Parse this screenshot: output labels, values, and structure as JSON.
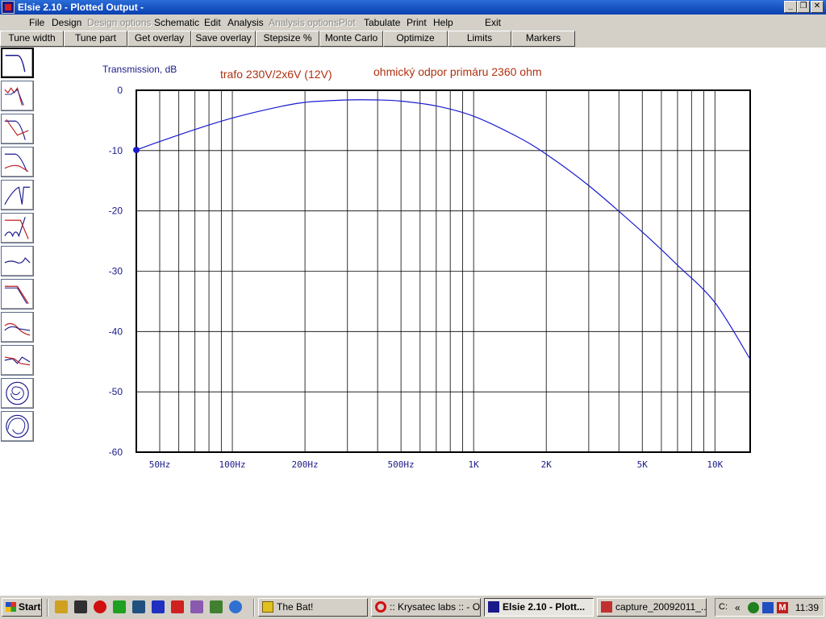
{
  "window": {
    "title": "Elsie 2.10 - Plotted Output -",
    "controls": {
      "minimize": "_",
      "restore": "❐",
      "close": "✕"
    }
  },
  "menu": {
    "file": "File",
    "design": "Design",
    "design_options": "Design options",
    "schematic": "Schematic",
    "edit": "Edit",
    "analysis": "Analysis",
    "analysis_options": "Analysis options",
    "plot": "Plot",
    "tabulate": "Tabulate",
    "print": "Print",
    "help": "Help",
    "exit": "Exit"
  },
  "toolbar": {
    "tune_width": "Tune width",
    "tune_part": "Tune part",
    "get_overlay": "Get overlay",
    "save_overlay": "Save overlay",
    "stepsize": "Stepsize %",
    "monte_carlo": "Monte Carlo",
    "optimize": "Optimize",
    "limits": "Limits",
    "markers": "Markers"
  },
  "sidebar": {
    "icons": [
      "lowpass-response-icon",
      "ripple-lowpass-icon",
      "lowpass-phase-icon",
      "lowpass-delay-icon",
      "highpass-notch-icon",
      "bandstop-icon",
      "step-response-icon",
      "rolloff-icon",
      "bandpass-icon",
      "crossover-icon",
      "smith-chart-icon",
      "polar-chart-icon"
    ]
  },
  "chart_data": {
    "type": "line",
    "ylabel": "Transmission, dB",
    "annotations": [
      "trafo 230V/2x6V  (12V)",
      "ohmický odpor primáru 2360 ohm"
    ],
    "x_scale": "log",
    "xlim": [
      40,
      14000
    ],
    "ylim": [
      -60,
      0
    ],
    "y_ticks": [
      0,
      -10,
      -20,
      -30,
      -40,
      -50,
      -60
    ],
    "x_tick_labels": [
      {
        "value": 50,
        "label": "50Hz"
      },
      {
        "value": 100,
        "label": "100Hz"
      },
      {
        "value": 200,
        "label": "200Hz"
      },
      {
        "value": 500,
        "label": "500Hz"
      },
      {
        "value": 1000,
        "label": "1K"
      },
      {
        "value": 2000,
        "label": "2K"
      },
      {
        "value": 5000,
        "label": "5K"
      },
      {
        "value": 10000,
        "label": "10K"
      }
    ],
    "grid": true,
    "series": [
      {
        "color": "#1a1ad0",
        "x": [
          40,
          50,
          70,
          100,
          150,
          200,
          300,
          400,
          500,
          700,
          1000,
          1500,
          2000,
          3000,
          5000,
          7000,
          10000,
          14000
        ],
        "y": [
          -9.9,
          -8.5,
          -6.5,
          -4.6,
          -2.9,
          -2.0,
          -1.6,
          -1.6,
          -1.8,
          -2.6,
          -4.3,
          -7.6,
          -10.6,
          -15.8,
          -23.5,
          -29.0,
          -35.2,
          -44.6
        ]
      }
    ],
    "marker": {
      "x": 40,
      "y": -9.9
    }
  },
  "taskbar": {
    "start": "Start",
    "quick_launch": [
      "winamp-icon",
      "bat-icon",
      "opera-icon",
      "frog-icon",
      "shield-icon",
      "floppy-icon",
      "splash-icon",
      "info-icon",
      "tray-icon",
      "refresh-icon"
    ],
    "tasks": [
      {
        "label": "The Bat!",
        "icon": "bat-icon"
      },
      {
        "label": ":: Krysatec labs :: - O...",
        "icon": "opera-icon"
      },
      {
        "label": "Elsie 2.10 - Plott...",
        "icon": "elsie-icon"
      },
      {
        "label": "capture_20092011_...",
        "icon": "capture-icon"
      }
    ],
    "tray_label": "C:",
    "clock": "11:39"
  }
}
